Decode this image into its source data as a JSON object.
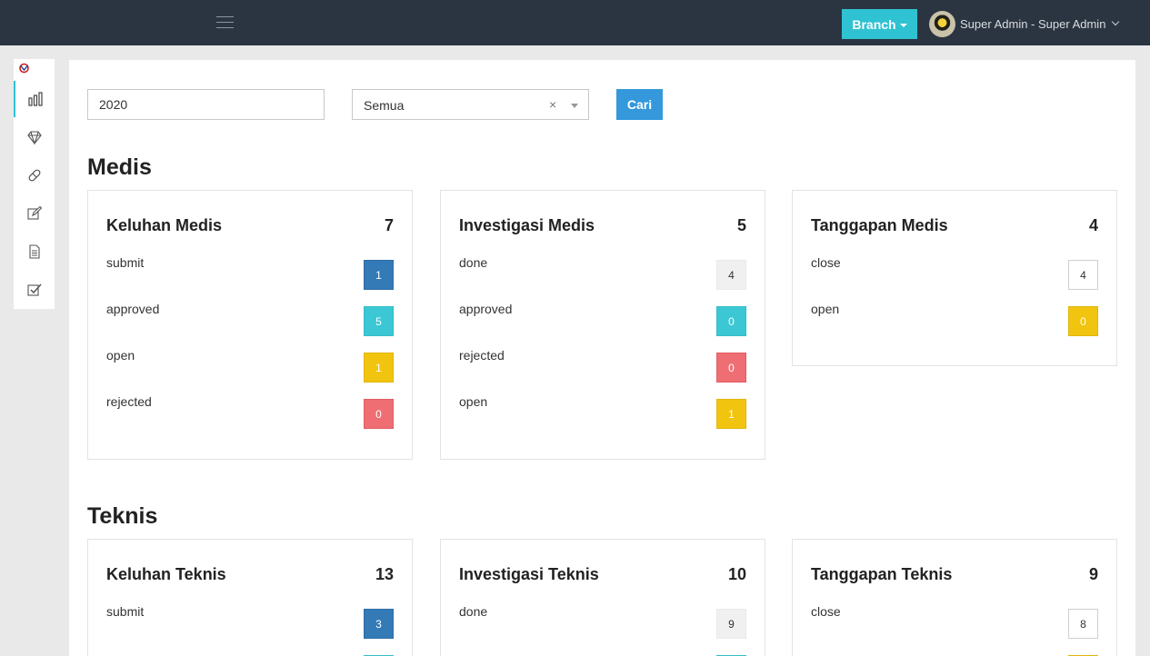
{
  "topbar": {
    "branch_label": "Branch",
    "user_name": "Super Admin - Super Admin"
  },
  "sidebar": {
    "items": [
      {
        "icon": "bar-chart-icon"
      },
      {
        "icon": "diamond-icon"
      },
      {
        "icon": "pill-icon"
      },
      {
        "icon": "edit-icon"
      },
      {
        "icon": "document-icon"
      },
      {
        "icon": "checkbox-icon"
      }
    ]
  },
  "filters": {
    "year_value": "2020",
    "category_value": "Semua",
    "clear_glyph": "×",
    "search_label": "Cari"
  },
  "sections": {
    "medis": {
      "title": "Medis",
      "cards": [
        {
          "title": "Keluhan Medis",
          "total": "7",
          "rows": [
            {
              "label": "submit",
              "value": "1",
              "color": "#337ab7"
            },
            {
              "label": "approved",
              "value": "5",
              "color": "#3bc7d4"
            },
            {
              "label": "open",
              "value": "1",
              "color": "#f1c40f"
            },
            {
              "label": "rejected",
              "value": "0",
              "color": "#ee6e73"
            }
          ]
        },
        {
          "title": "Investigasi Medis",
          "total": "5",
          "rows": [
            {
              "label": "done",
              "value": "4",
              "color": "#f0f0f0"
            },
            {
              "label": "approved",
              "value": "0",
              "color": "#3bc7d4"
            },
            {
              "label": "rejected",
              "value": "0",
              "color": "#ee6e73"
            },
            {
              "label": "open",
              "value": "1",
              "color": "#f1c40f"
            }
          ]
        },
        {
          "title": "Tanggapan Medis",
          "total": "4",
          "rows": [
            {
              "label": "close",
              "value": "4",
              "color": "#ffffff"
            },
            {
              "label": "open",
              "value": "0",
              "color": "#f1c40f"
            }
          ]
        }
      ]
    },
    "teknis": {
      "title": "Teknis",
      "cards": [
        {
          "title": "Keluhan Teknis",
          "total": "13",
          "rows": [
            {
              "label": "submit",
              "value": "3",
              "color": "#337ab7"
            }
          ]
        },
        {
          "title": "Investigasi Teknis",
          "total": "10",
          "rows": [
            {
              "label": "done",
              "value": "9",
              "color": "#f0f0f0"
            }
          ]
        },
        {
          "title": "Tanggapan Teknis",
          "total": "9",
          "rows": [
            {
              "label": "close",
              "value": "8",
              "color": "#ffffff"
            }
          ]
        }
      ]
    }
  }
}
